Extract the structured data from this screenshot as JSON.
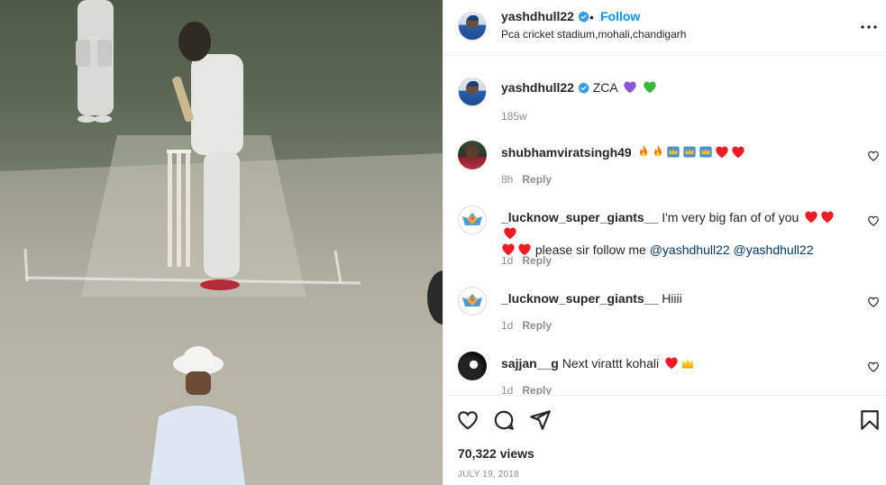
{
  "post": {
    "username": "yashdhull22",
    "location": "Pca cricket stadium,mohali,chandigarh",
    "follow_label": "Follow",
    "dot": "•",
    "caption": "ZCA",
    "caption_age": "185w",
    "views": "70,322 views",
    "date": "JULY 19, 2018"
  },
  "comments": [
    {
      "username": "shubhamviratsingh49",
      "text": "",
      "age": "8h",
      "reply_label": "Reply",
      "emojis": [
        "fire",
        "fire",
        "crown",
        "crown",
        "crown",
        "red-heart",
        "red-heart"
      ]
    },
    {
      "username": "_lucknow_super_giants__",
      "text": "I'm very big fan of of you",
      "text2": "please sir follow me",
      "mention1": "@yashdhull22",
      "mention2": "@yashdhull22",
      "age": "1d",
      "reply_label": "Reply"
    },
    {
      "username": "_lucknow_super_giants__",
      "text": "Hiiii",
      "age": "1d",
      "reply_label": "Reply"
    },
    {
      "username": "sajjan__g",
      "text": "Next virattt kohali",
      "age": "1d",
      "reply_label": "Reply"
    }
  ],
  "colors": {
    "accent": "#0095f6",
    "verified": "#3897f0",
    "muted": "#8e8e8e",
    "heart": "#ed1c24",
    "purple_heart": "#8a56d6",
    "green_heart": "#3bb53b"
  },
  "icons": [
    "more-icon",
    "verified-icon",
    "heart-icon",
    "comment-icon",
    "share-icon",
    "bookmark-icon"
  ]
}
